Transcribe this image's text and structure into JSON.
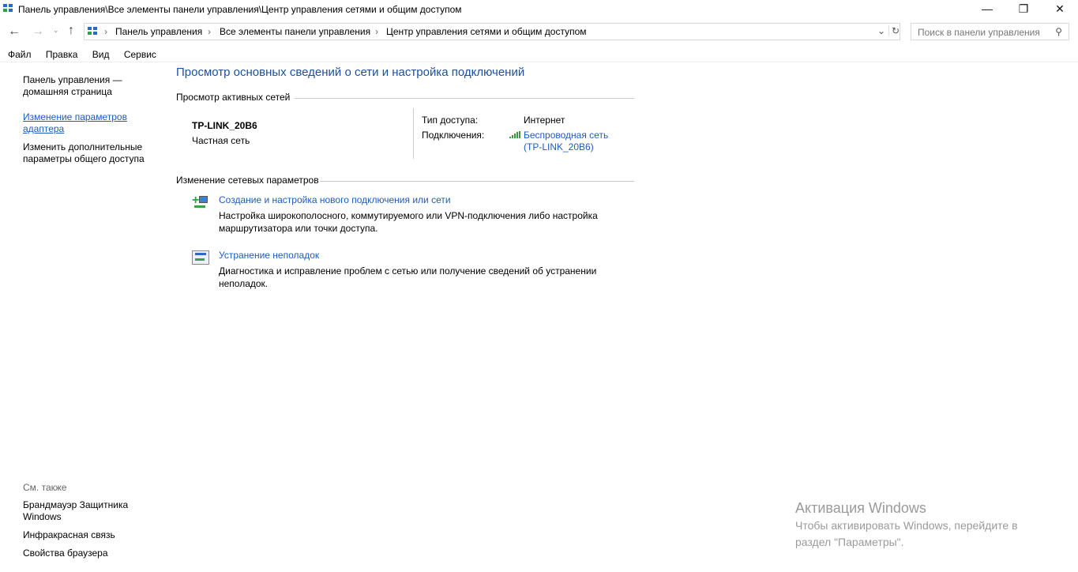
{
  "window": {
    "title": "Панель управления\\Все элементы панели управления\\Центр управления сетями и общим доступом"
  },
  "address": {
    "crumbs": [
      "Панель управления",
      "Все элементы панели управления",
      "Центр управления сетями и общим доступом"
    ]
  },
  "search": {
    "placeholder": "Поиск в панели управления"
  },
  "menu": [
    "Файл",
    "Правка",
    "Вид",
    "Сервис"
  ],
  "sidebar": {
    "links": [
      "Панель управления — домашняя страница",
      "Изменение параметров адаптера",
      "Изменить дополнительные параметры общего доступа"
    ],
    "see_also_title": "См. также",
    "see_also": [
      "Брандмауэр Защитника Windows",
      "Инфракрасная связь",
      "Свойства браузера"
    ]
  },
  "main": {
    "title": "Просмотр основных сведений о сети и настройка подключений",
    "active_title": "Просмотр активных сетей",
    "network_name": "TP-LINK_20B6",
    "network_type": "Частная сеть",
    "access_label": "Тип доступа:",
    "access_value": "Интернет",
    "conn_label": "Подключения:",
    "conn_line1": "Беспроводная сеть",
    "conn_line2": "(TP-LINK_20B6)",
    "change_title": "Изменение сетевых параметров",
    "tasks": [
      {
        "title": "Создание и настройка нового подключения или сети",
        "desc1": "Настройка широкополосного, коммутируемого или VPN-подключения либо настройка",
        "desc2": "маршрутизатора или точки доступа."
      },
      {
        "title": "Устранение неполадок",
        "desc1": "Диагностика и исправление проблем с сетью или получение сведений об устранении",
        "desc2": "неполадок."
      }
    ]
  },
  "watermark": {
    "title": "Активация Windows",
    "line1": "Чтобы активировать Windows, перейдите в",
    "line2": "раздел \"Параметры\"."
  }
}
